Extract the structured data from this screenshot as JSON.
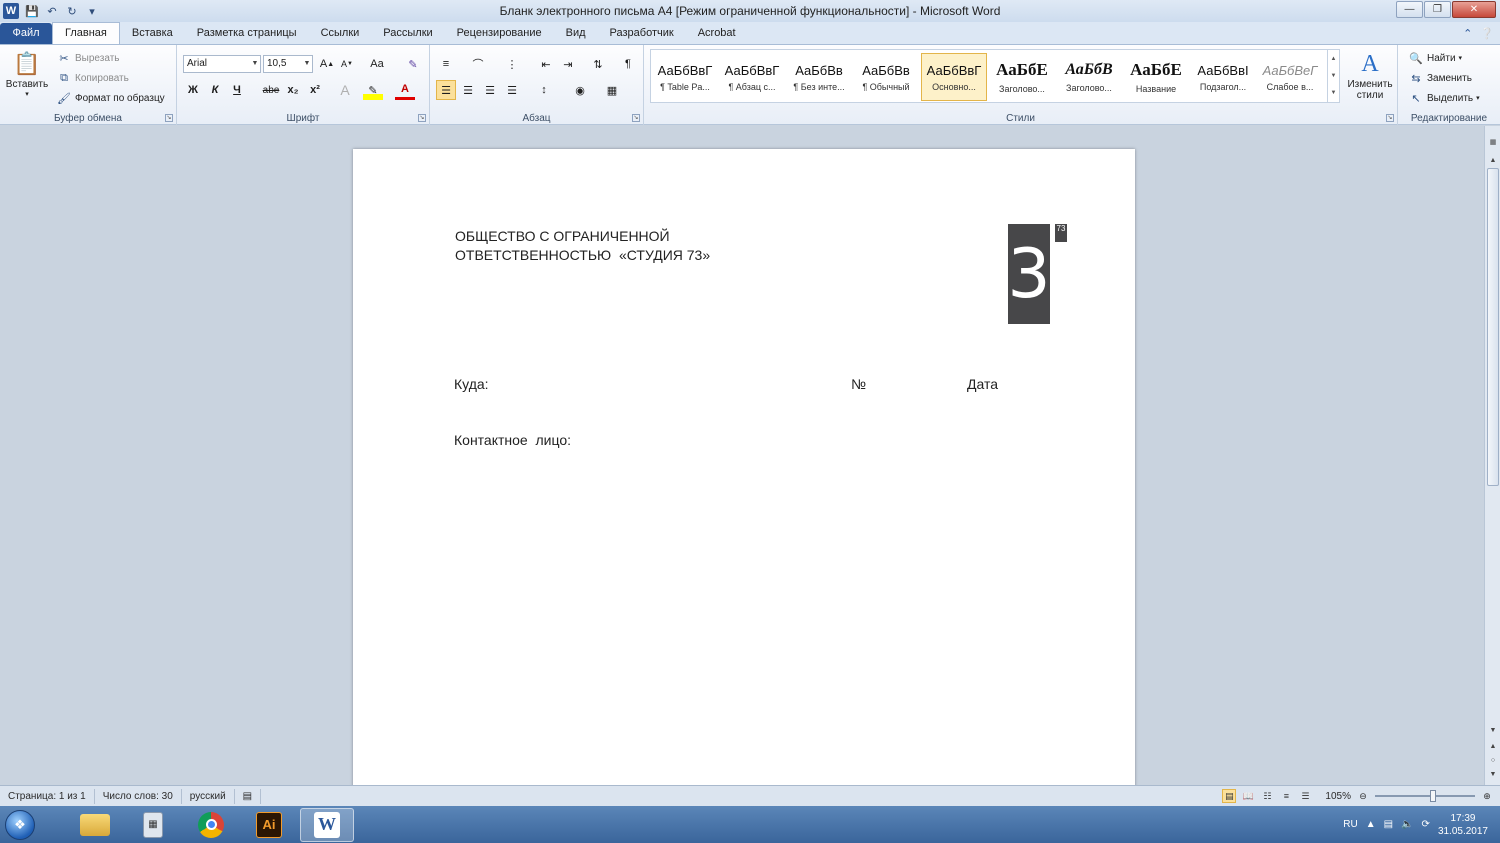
{
  "window": {
    "title": "Бланк электронного письма А4 [Режим ограниченной функциональности] - Microsoft Word",
    "app_icon": "W"
  },
  "tabs": [
    {
      "label": "Файл"
    },
    {
      "label": "Главная"
    },
    {
      "label": "Вставка"
    },
    {
      "label": "Разметка страницы"
    },
    {
      "label": "Ссылки"
    },
    {
      "label": "Рассылки"
    },
    {
      "label": "Рецензирование"
    },
    {
      "label": "Вид"
    },
    {
      "label": "Разработчик"
    },
    {
      "label": "Acrobat"
    }
  ],
  "clipboard": {
    "group_label": "Буфер обмена",
    "paste": "Вставить",
    "cut": "Вырезать",
    "copy": "Копировать",
    "format_painter": "Формат по образцу"
  },
  "font": {
    "group_label": "Шрифт",
    "font_name": "Arial",
    "font_size": "10,5",
    "bold": "Ж",
    "italic": "К",
    "underline": "Ч",
    "strike": "abe",
    "subscript": "x₂",
    "superscript": "x²",
    "grow": "A",
    "case": "Aa"
  },
  "paragraph": {
    "group_label": "Абзац"
  },
  "styles": {
    "group_label": "Стили",
    "items": [
      {
        "preview": "АаБбВвГ",
        "name": "¶ Table Pa..."
      },
      {
        "preview": "АаБбВвГ",
        "name": "¶ Абзац с..."
      },
      {
        "preview": "АаБбВв",
        "name": "¶ Без инте..."
      },
      {
        "preview": "АаБбВв",
        "name": "¶ Обычный"
      },
      {
        "preview": "АаБбВвГ",
        "name": "Основно..."
      },
      {
        "preview": "АаБбЕ",
        "name": "Заголово..."
      },
      {
        "preview": "АаБбВ",
        "name": "Заголово..."
      },
      {
        "preview": "АаБбЕ",
        "name": "Название"
      },
      {
        "preview": "АаБбВвІ",
        "name": "Подзагол..."
      },
      {
        "preview": "АаБбВеГ",
        "name": "Слабое в..."
      }
    ],
    "change_styles": "Изменить стили"
  },
  "editing": {
    "group_label": "Редактирование",
    "find": "Найти",
    "replace": "Заменить",
    "select": "Выделить"
  },
  "document": {
    "company_line1": "ОБЩЕСТВО С ОГРАНИЧЕННОЙ",
    "company_line2": "ОТВЕТСТВЕННОСТЬЮ  «СТУДИЯ 73»",
    "logo_digit": "3",
    "logo_sup": "73",
    "to_label": "Куда:",
    "number_label": "№",
    "date_label": "Дата",
    "contact_label": "Контактное  лицо:"
  },
  "status": {
    "page": "Страница: 1 из 1",
    "words": "Число слов: 30",
    "language": "русский",
    "zoom": "105%"
  },
  "taskbar": {
    "lang": "RU",
    "time": "17:39",
    "date": "31.05.2017"
  }
}
